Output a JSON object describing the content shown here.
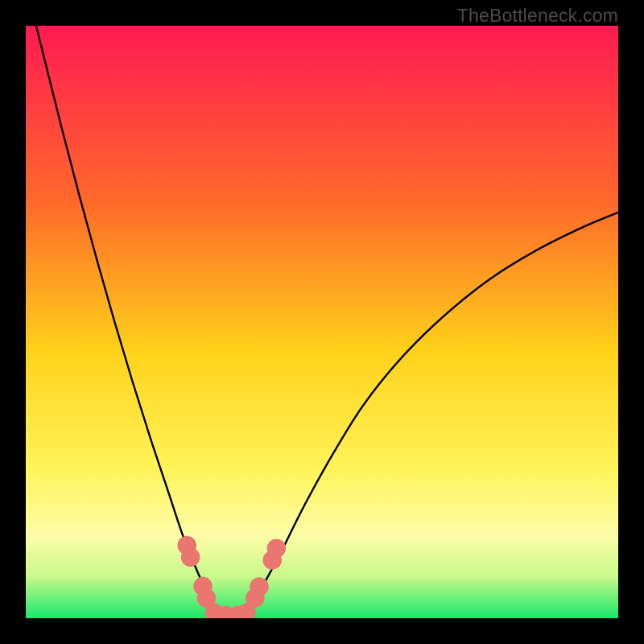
{
  "watermark": "TheBottleneck.com",
  "chart_data": {
    "type": "line",
    "title": "",
    "xlabel": "",
    "ylabel": "",
    "xlim": [
      0,
      100
    ],
    "ylim": [
      0,
      100
    ],
    "background_gradient": {
      "stops": [
        {
          "pos": 0.0,
          "color": "#ff1a52"
        },
        {
          "pos": 0.3,
          "color": "#ff6a2a"
        },
        {
          "pos": 0.55,
          "color": "#ffd21a"
        },
        {
          "pos": 0.75,
          "color": "#fff45a"
        },
        {
          "pos": 0.86,
          "color": "#fdfda8"
        },
        {
          "pos": 0.93,
          "color": "#c8f98a"
        },
        {
          "pos": 1.0,
          "color": "#17e86a"
        }
      ]
    },
    "series": [
      {
        "name": "left-curve",
        "comment": "Descending curve from upper-left into trough",
        "x": [
          0,
          3,
          6,
          9,
          12,
          15,
          18,
          21,
          24,
          26.5,
          28.5,
          30,
          31,
          31.8,
          32.5
        ],
        "y": [
          107,
          95,
          83,
          71.5,
          60.5,
          50,
          40,
          30.5,
          21.5,
          14,
          9,
          5.5,
          3.2,
          1.5,
          0.5
        ]
      },
      {
        "name": "right-curve",
        "comment": "Ascending curve from trough toward upper right, flattening",
        "x": [
          36.5,
          38,
          40,
          43,
          47,
          52,
          57,
          63,
          70,
          78,
          86,
          94,
          100
        ],
        "y": [
          0.5,
          2.2,
          5.5,
          11,
          19,
          28,
          36,
          43.5,
          50.5,
          57,
          62,
          66,
          68.5
        ]
      },
      {
        "name": "trough-floor",
        "comment": "Flat bottom segment of the V",
        "x": [
          32.5,
          36.5
        ],
        "y": [
          0.5,
          0.5
        ]
      }
    ],
    "markers": {
      "comment": "Salmon-pink lumpy markers near the trough",
      "color": "#e9776f",
      "points": [
        {
          "x": 27.2,
          "y": 12.3,
          "r": 1.6
        },
        {
          "x": 27.8,
          "y": 10.3,
          "r": 1.6
        },
        {
          "x": 29.9,
          "y": 5.4,
          "r": 1.6
        },
        {
          "x": 30.5,
          "y": 3.4,
          "r": 1.6
        },
        {
          "x": 31.8,
          "y": 1.0,
          "r": 1.55
        },
        {
          "x": 33.8,
          "y": 0.55,
          "r": 1.55
        },
        {
          "x": 35.8,
          "y": 0.55,
          "r": 1.55
        },
        {
          "x": 37.3,
          "y": 1.0,
          "r": 1.55
        },
        {
          "x": 38.7,
          "y": 3.4,
          "r": 1.6
        },
        {
          "x": 39.4,
          "y": 5.3,
          "r": 1.6
        },
        {
          "x": 41.6,
          "y": 9.8,
          "r": 1.6
        },
        {
          "x": 42.3,
          "y": 11.8,
          "r": 1.6
        }
      ]
    }
  }
}
